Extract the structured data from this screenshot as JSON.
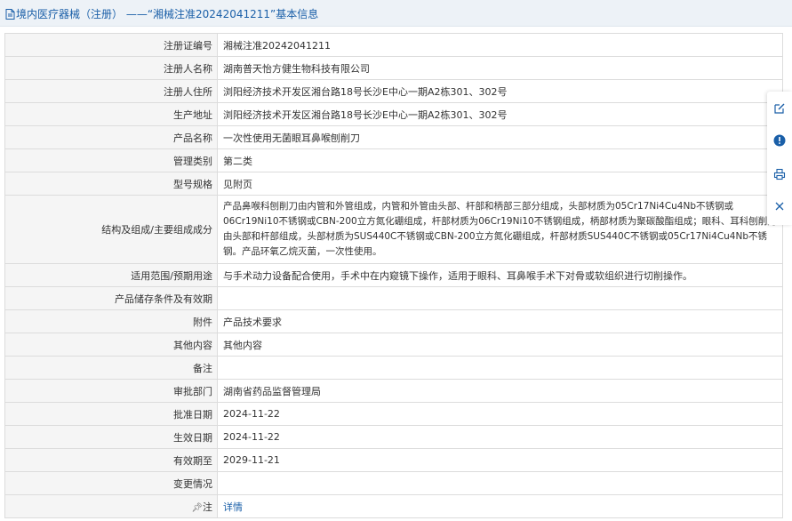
{
  "header": {
    "title": "境内医疗器械（注册） ——“湘械注准20242041211”基本信息"
  },
  "rows": [
    {
      "key": "注册证编号",
      "value": "湘械注准20242041211"
    },
    {
      "key": "注册人名称",
      "value": "湖南普天怡方健生物科技有限公司"
    },
    {
      "key": "注册人住所",
      "value": "浏阳经济技术开发区湘台路18号长沙E中心一期A2栋301、302号"
    },
    {
      "key": "生产地址",
      "value": "浏阳经济技术开发区湘台路18号长沙E中心一期A2栋301、302号"
    },
    {
      "key": "产品名称",
      "value": "一次性使用无菌眼耳鼻喉刨削刀"
    },
    {
      "key": "管理类别",
      "value": "第二类"
    },
    {
      "key": "型号规格",
      "value": "见附页"
    },
    {
      "key": "结构及组成/主要组成成分",
      "value": "产品鼻喉科刨削刀由内管和外管组成，内管和外管由头部、杆部和柄部三部分组成，头部材质为05Cr17Ni4Cu4Nb不锈钢或06Cr19Ni10不锈钢或CBN-200立方氮化硼组成，杆部材质为06Cr19Ni10不锈钢组成，柄部材质为聚碳酸酯组成；眼科、耳科刨削刀由头部和杆部组成，头部材质为SUS440C不锈钢或CBN-200立方氮化硼组成，杆部材质SUS440C不锈钢或05Cr17Ni4Cu4Nb不锈钢。产品环氧乙烷灭菌，一次性使用。"
    },
    {
      "key": "适用范围/预期用途",
      "value": "与手术动力设备配合使用，手术中在内窥镜下操作，适用于眼科、耳鼻喉手术下对骨或软组织进行切削操作。"
    },
    {
      "key": "产品储存条件及有效期",
      "value": ""
    },
    {
      "key": "附件",
      "value": "产品技术要求"
    },
    {
      "key": "其他内容",
      "value": "其他内容"
    },
    {
      "key": "备注",
      "value": ""
    },
    {
      "key": "审批部门",
      "value": "湖南省药品监督管理局"
    },
    {
      "key": "批准日期",
      "value": "2024-11-22"
    },
    {
      "key": "生效日期",
      "value": "2024-11-22"
    },
    {
      "key": "有效期至",
      "value": "2029-11-21"
    },
    {
      "key": "变更情况",
      "value": ""
    },
    {
      "key": "注",
      "value": "详情"
    }
  ],
  "note_icon": "pin-icon",
  "floatbar": {
    "icons": [
      "edit-icon",
      "help-icon",
      "print-icon",
      "close-icon"
    ],
    "accent": "#1a5fa8"
  }
}
